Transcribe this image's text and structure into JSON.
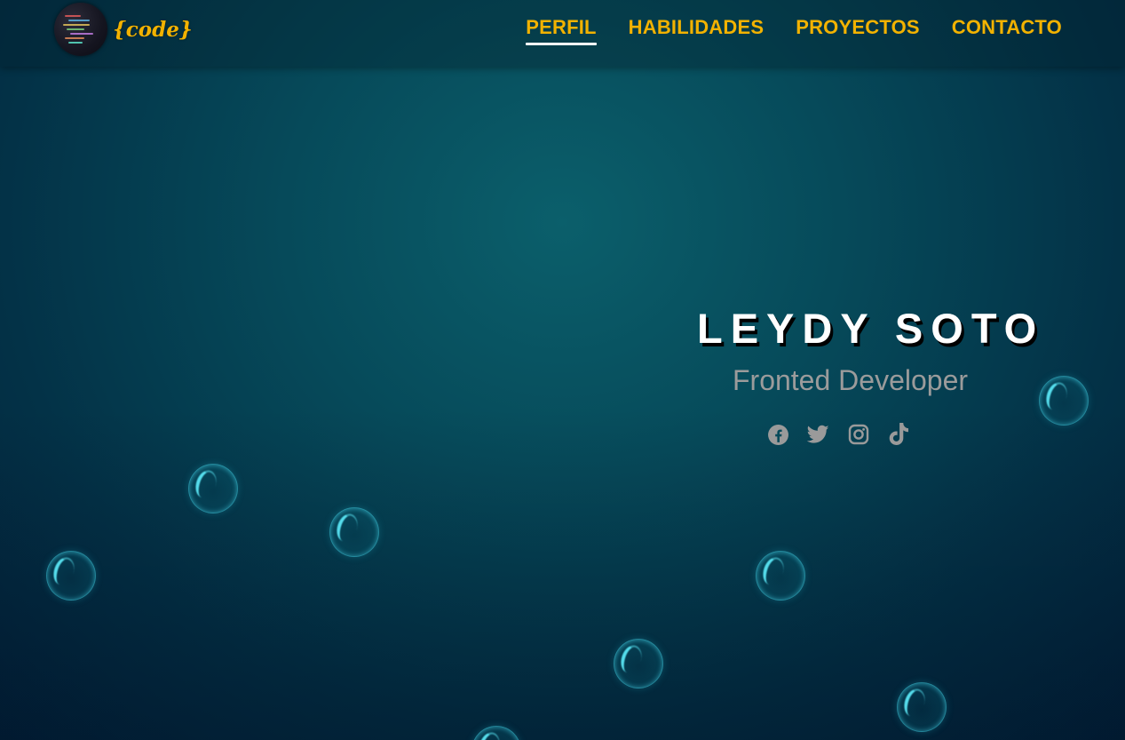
{
  "brand": {
    "logo_text": "{code}",
    "logo_icon": "code-editor-avatar"
  },
  "nav": {
    "items": [
      {
        "label": "PERFIL",
        "active": true
      },
      {
        "label": "HABILIDADES",
        "active": false
      },
      {
        "label": "PROYECTOS",
        "active": false
      },
      {
        "label": "CONTACTO",
        "active": false
      }
    ]
  },
  "hero": {
    "name": "LEYDY SOTO",
    "role": "Fronted Developer"
  },
  "socials": [
    {
      "icon": "facebook-icon"
    },
    {
      "icon": "twitter-icon"
    },
    {
      "icon": "instagram-icon"
    },
    {
      "icon": "tiktok-icon"
    }
  ],
  "colors": {
    "accent": "#f2b200",
    "background": "#064a5a",
    "text_light": "#ffffff",
    "text_muted": "#9b9b9b",
    "bubble": "#3fd6e8"
  }
}
